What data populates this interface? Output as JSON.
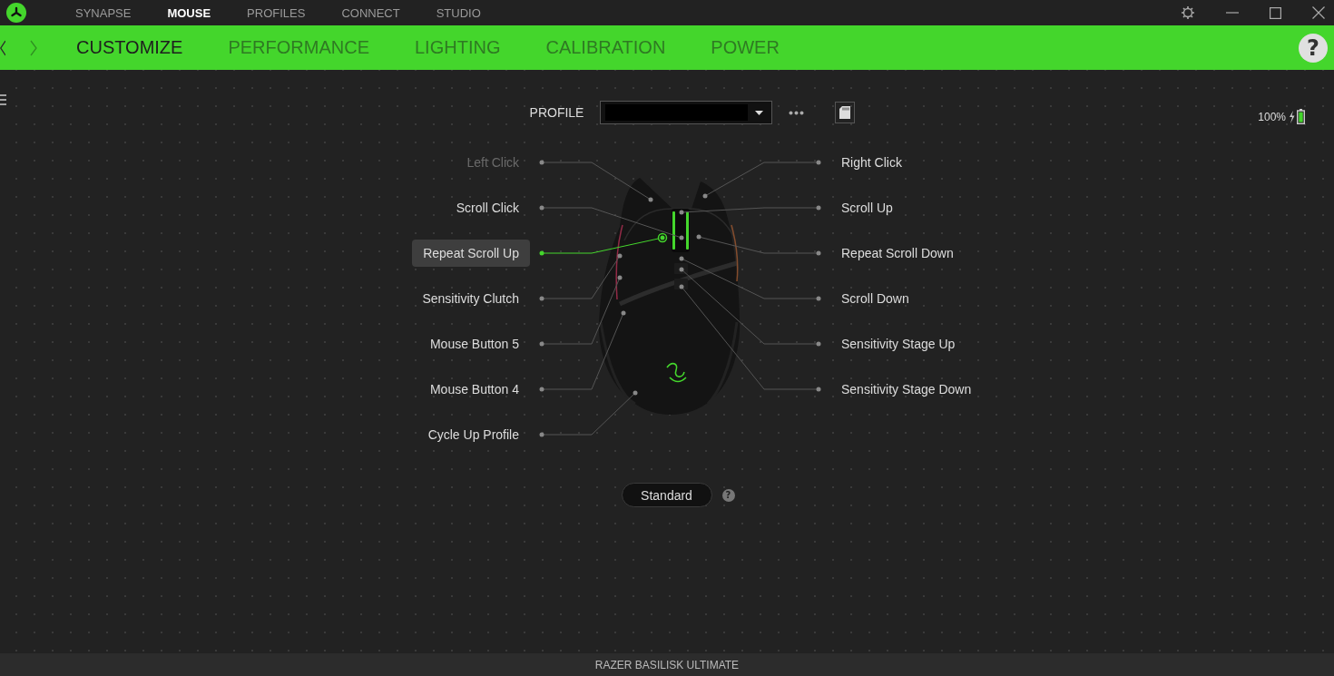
{
  "app_nav": {
    "items": [
      {
        "label": "SYNAPSE",
        "selected": false
      },
      {
        "label": "MOUSE",
        "selected": true
      },
      {
        "label": "PROFILES",
        "selected": false
      },
      {
        "label": "CONNECT",
        "selected": false
      },
      {
        "label": "STUDIO",
        "selected": false
      }
    ]
  },
  "sub_nav": {
    "tabs": [
      {
        "label": "CUSTOMIZE",
        "selected": true
      },
      {
        "label": "PERFORMANCE",
        "selected": false
      },
      {
        "label": "LIGHTING",
        "selected": false
      },
      {
        "label": "CALIBRATION",
        "selected": false
      },
      {
        "label": "POWER",
        "selected": false
      }
    ],
    "help": "?"
  },
  "profile": {
    "label": "PROFILE"
  },
  "battery": {
    "reading": "100%",
    "charging": true
  },
  "buttons": {
    "left": [
      {
        "label": "Left Click",
        "selected": false,
        "disabled": true
      },
      {
        "label": "Scroll Click",
        "selected": false,
        "disabled": false
      },
      {
        "label": "Repeat Scroll Up",
        "selected": true,
        "disabled": false
      },
      {
        "label": "Sensitivity Clutch",
        "selected": false,
        "disabled": false
      },
      {
        "label": "Mouse Button 5",
        "selected": false,
        "disabled": false
      },
      {
        "label": "Mouse Button 4",
        "selected": false,
        "disabled": false
      },
      {
        "label": "Cycle Up Profile",
        "selected": false,
        "disabled": false
      }
    ],
    "right": [
      {
        "label": "Right Click",
        "selected": false,
        "disabled": false
      },
      {
        "label": "Scroll Up",
        "selected": false,
        "disabled": false
      },
      {
        "label": "Repeat Scroll Down",
        "selected": false,
        "disabled": false
      },
      {
        "label": "Scroll Down",
        "selected": false,
        "disabled": false
      },
      {
        "label": "Sensitivity Stage Up",
        "selected": false,
        "disabled": false
      },
      {
        "label": "Sensitivity Stage Down",
        "selected": false,
        "disabled": false
      }
    ]
  },
  "mode": {
    "label": "Standard",
    "help": "?"
  },
  "status_bar": {
    "device": "RAZER BASILISK ULTIMATE"
  }
}
